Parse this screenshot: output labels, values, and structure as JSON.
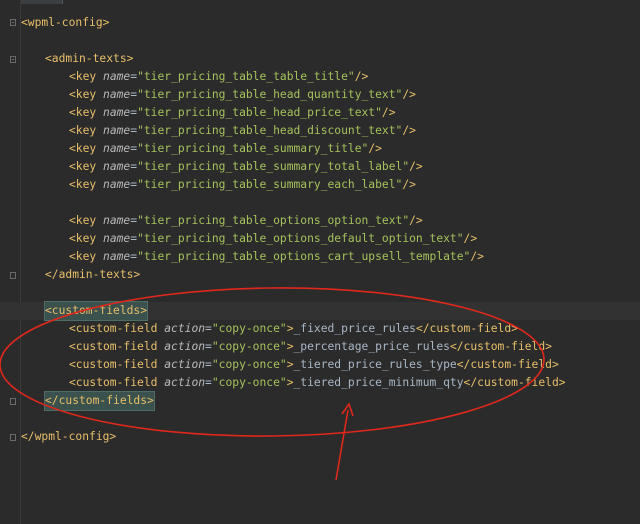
{
  "lines": [
    {
      "tag_open": "<wpml-config>"
    },
    {
      "tag_open": "<admin-texts>"
    },
    {
      "key_tag": "<key",
      "attr": "name",
      "eq": "=",
      "value": "\"tier_pricing_table_table_title\"",
      "close": "/>"
    },
    {
      "key_tag": "<key",
      "attr": "name",
      "eq": "=",
      "value": "\"tier_pricing_table_head_quantity_text\"",
      "close": "/>"
    },
    {
      "key_tag": "<key",
      "attr": "name",
      "eq": "=",
      "value": "\"tier_pricing_table_head_price_text\"",
      "close": "/>"
    },
    {
      "key_tag": "<key",
      "attr": "name",
      "eq": "=",
      "value": "\"tier_pricing_table_head_discount_text\"",
      "close": "/>"
    },
    {
      "key_tag": "<key",
      "attr": "name",
      "eq": "=",
      "value": "\"tier_pricing_table_summary_title\"",
      "close": "/>"
    },
    {
      "key_tag": "<key",
      "attr": "name",
      "eq": "=",
      "value": "\"tier_pricing_table_summary_total_label\"",
      "close": "/>"
    },
    {
      "key_tag": "<key",
      "attr": "name",
      "eq": "=",
      "value": "\"tier_pricing_table_summary_each_label\"",
      "close": "/>"
    },
    {
      "key_tag": "<key",
      "attr": "name",
      "eq": "=",
      "value": "\"tier_pricing_table_options_option_text\"",
      "close": "/>"
    },
    {
      "key_tag": "<key",
      "attr": "name",
      "eq": "=",
      "value": "\"tier_pricing_table_options_default_option_text\"",
      "close": "/>"
    },
    {
      "key_tag": "<key",
      "attr": "name",
      "eq": "=",
      "value": "\"tier_pricing_table_options_cart_upsell_template\"",
      "close": "/>"
    },
    {
      "tag_close": "</admin-texts>"
    },
    {
      "tag_open": "<custom-fields>"
    },
    {
      "cf_open": "<custom-field",
      "attr": "action",
      "eq": "=",
      "value": "\"copy-once\"",
      "gt": ">",
      "text": "_fixed_price_rules",
      "cf_close": "</custom-field>"
    },
    {
      "cf_open": "<custom-field",
      "attr": "action",
      "eq": "=",
      "value": "\"copy-once\"",
      "gt": ">",
      "text": "_percentage_price_rules",
      "cf_close": "</custom-field>"
    },
    {
      "cf_open": "<custom-field",
      "attr": "action",
      "eq": "=",
      "value": "\"copy-once\"",
      "gt": ">",
      "text": "_tiered_price_rules_type",
      "cf_close": "</custom-field>"
    },
    {
      "cf_open": "<custom-field",
      "attr": "action",
      "eq": "=",
      "value": "\"copy-once\"",
      "gt": ">",
      "text": "_tiered_price_minimum_qty",
      "cf_close": "</custom-field>"
    },
    {
      "tag_close": "</custom-fields>"
    },
    {
      "tag_close": "</wpml-config>"
    }
  ],
  "colors": {
    "background": "#2b2b2b",
    "tag": "#e8bf6a",
    "attribute": "#bababa",
    "string": "#a5c25c",
    "text": "#a9b7c6",
    "annotation": "#e0281c"
  }
}
